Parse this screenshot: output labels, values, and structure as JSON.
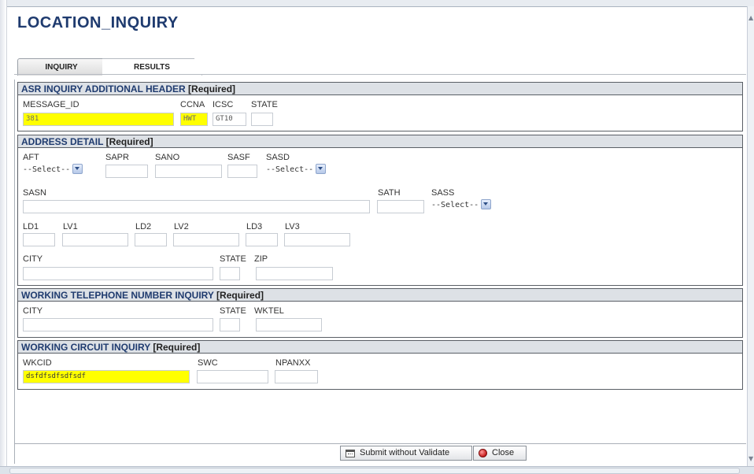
{
  "page": {
    "title": "LOCATION_INQUIRY"
  },
  "tabs": [
    {
      "label": "INQUIRY"
    },
    {
      "label": "RESULTS"
    }
  ],
  "sections": {
    "asr_header": {
      "title": "ASR INQUIRY ADDITIONAL HEADER",
      "required": "[Required]",
      "message_id_label": "MESSAGE_ID",
      "message_id_value": "381",
      "ccna_label": "CCNA",
      "ccna_value": "HWT",
      "icsc_label": "ICSC",
      "icsc_value": "GT10",
      "state_label": "STATE",
      "state_value": ""
    },
    "address_detail": {
      "title": "ADDRESS DETAIL",
      "required": "[Required]",
      "aft_label": "AFT",
      "aft_value": "--Select--",
      "sapr_label": "SAPR",
      "sano_label": "SANO",
      "sasf_label": "SASF",
      "sasd_label": "SASD",
      "sasd_value": "--Select--",
      "sasn_label": "SASN",
      "sath_label": "SATH",
      "sass_label": "SASS",
      "sass_value": "--Select--",
      "ld1_label": "LD1",
      "lv1_label": "LV1",
      "ld2_label": "LD2",
      "lv2_label": "LV2",
      "ld3_label": "LD3",
      "lv3_label": "LV3",
      "city_label": "CITY",
      "state_label": "STATE",
      "zip_label": "ZIP"
    },
    "wtn_inquiry": {
      "title": "WORKING TELEPHONE NUMBER INQUIRY",
      "required": "[Required]",
      "city_label": "CITY",
      "state_label": "STATE",
      "wktel_label": "WKTEL"
    },
    "circuit_inquiry": {
      "title": "WORKING CIRCUIT INQUIRY",
      "required": "[Required]",
      "wkcid_label": "WKCID",
      "wkcid_value": "dsfdfsdfsdfsdf",
      "swc_label": "SWC",
      "npanxx_label": "NPANXX"
    }
  },
  "footer": {
    "submit_label": "Submit without Validate",
    "close_label": "Close"
  },
  "colors": {
    "title": "#1f3b6f",
    "highlight": "#ffff00",
    "section_header_bg": "#dde1e6"
  },
  "icons": {
    "submit": "calendar-icon",
    "close": "red-circle-icon"
  }
}
